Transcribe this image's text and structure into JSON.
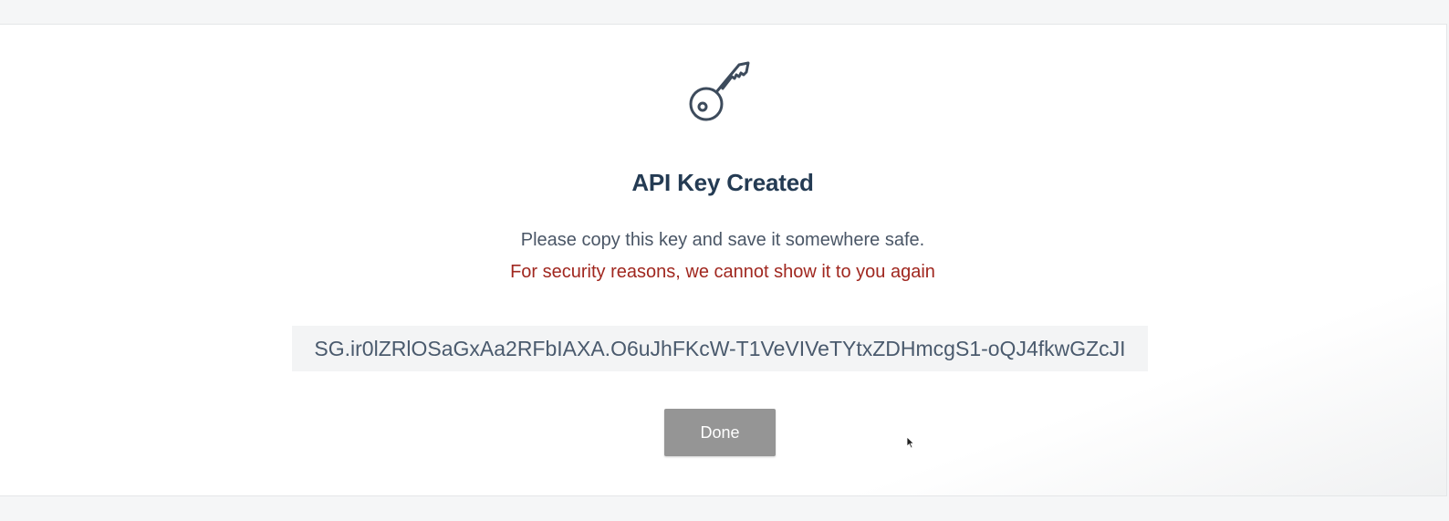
{
  "dialog": {
    "icon": "key-icon",
    "title": "API Key Created",
    "subtitle": "Please copy this key and save it somewhere safe.",
    "warning": "For security reasons, we cannot show it to you again",
    "api_key": "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",
    "done_label": "Done"
  },
  "colors": {
    "title": "#243b53",
    "warning": "#a0271f",
    "done_button": "#959595",
    "key_box_bg": "#f3f4f5"
  }
}
